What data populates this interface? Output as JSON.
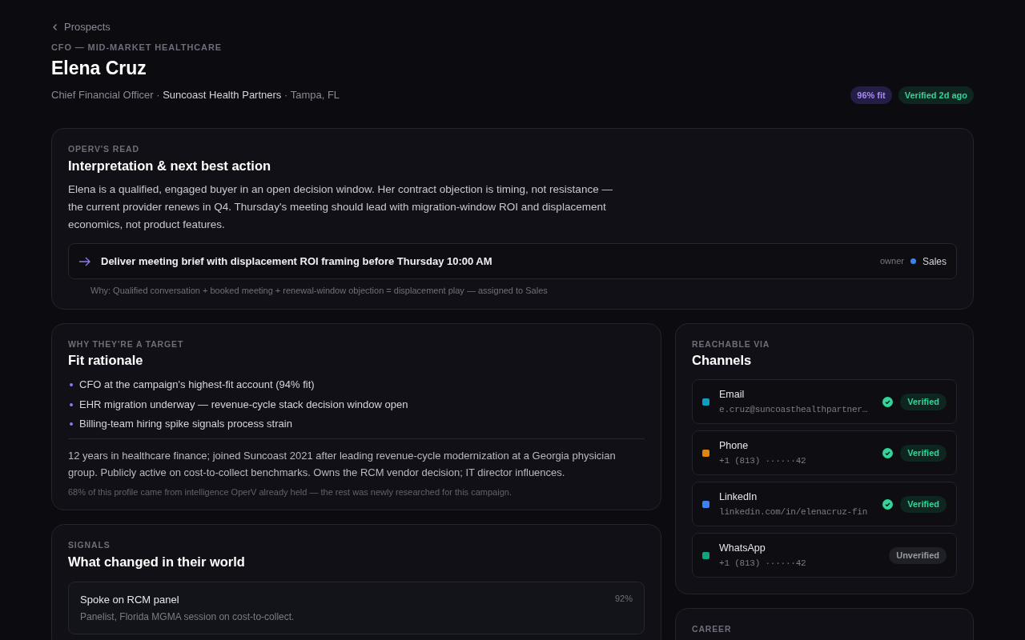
{
  "breadcrumb": {
    "label": "Prospects"
  },
  "header": {
    "eyebrow": "CFO — MID-MARKET HEALTHCARE",
    "name": "Elena Cruz",
    "role": "Chief Financial Officer",
    "company": "Suncoast Health Partners",
    "location": "Tampa, FL",
    "separator": "·",
    "badges": [
      {
        "kind": "fit",
        "label": "96% fit"
      },
      {
        "kind": "verified",
        "label": "Verified 2d ago"
      }
    ]
  },
  "read_card": {
    "eyebrow": "OPERV'S READ",
    "title": "Interpretation & next best action",
    "body": "Elena is a qualified, engaged buyer in an open decision window. Her contract objection is timing, not resistance — the current provider renews in Q4. Thursday's meeting should lead with migration-window ROI and displacement economics, not product features.",
    "action": {
      "label": "Deliver meeting brief with displacement ROI framing before Thursday 10:00 AM",
      "owner_label": "owner",
      "owner": "Sales"
    },
    "why": "Why: Qualified conversation + booked meeting + renewal-window objection = displacement play — assigned to Sales"
  },
  "fit_card": {
    "eyebrow": "WHY THEY'RE A TARGET",
    "title": "Fit rationale",
    "bullets": [
      "CFO at the campaign's highest-fit account (94% fit)",
      "EHR migration underway — revenue-cycle stack decision window open",
      "Billing-team hiring spike signals process strain"
    ],
    "summary": "12 years in healthcare finance; joined Suncoast 2021 after leading revenue-cycle modernization at a Georgia physician group. Publicly active on cost-to-collect benchmarks. Owns the RCM vendor decision; IT director influences.",
    "footnote": "68% of this profile came from intelligence OperV already held — the rest was newly researched for this campaign."
  },
  "signals_card": {
    "eyebrow": "SIGNALS",
    "title": "What changed in their world",
    "items": [
      {
        "title": "Spoke on RCM panel",
        "score": "92%",
        "detail": "Panelist, Florida MGMA session on cost-to-collect."
      }
    ]
  },
  "channels_card": {
    "eyebrow": "REACHABLE VIA",
    "title": "Channels",
    "items": [
      {
        "name": "Email",
        "value": "e.cruz@suncoasthealthpartner…",
        "color": "#0e9fbf",
        "verified": true,
        "status": "Verified"
      },
      {
        "name": "Phone",
        "value": "+1 (813) ······42",
        "color": "#e0850f",
        "verified": true,
        "status": "Verified"
      },
      {
        "name": "LinkedIn",
        "value": "linkedin.com/in/elenacruz-fin",
        "color": "#3b82f6",
        "verified": true,
        "status": "Verified"
      },
      {
        "name": "WhatsApp",
        "value": "+1 (813) ······42",
        "color": "#10a37f",
        "verified": false,
        "status": "Unverified"
      }
    ]
  },
  "career_card": {
    "eyebrow": "CAREER"
  }
}
